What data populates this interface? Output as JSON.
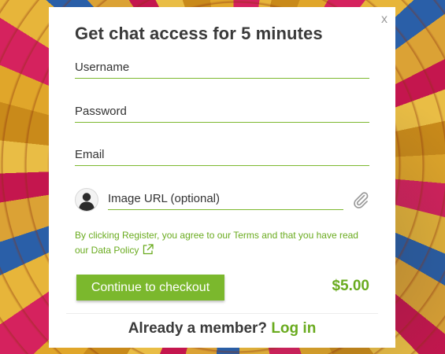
{
  "dialog": {
    "title": "Get chat access for 5 minutes",
    "close_label": "x"
  },
  "form": {
    "username_placeholder": "Username",
    "password_placeholder": "Password",
    "email_placeholder": "Email",
    "image_url_placeholder": "Image URL (optional)"
  },
  "icons": {
    "avatar": "user-silhouette-icon",
    "attach": "paperclip-icon",
    "external_link": "external-link-icon"
  },
  "terms": {
    "text": "By clicking Register, you agree to our Terms and that you have read our Data Policy"
  },
  "checkout": {
    "button_label": "Continue to checkout",
    "price": "$5.00"
  },
  "footer": {
    "prompt": "Already a member? ",
    "login_label": "Log in"
  },
  "colors": {
    "accent_green": "#7bb82d",
    "title_text": "#3a3a3a",
    "close_gray": "#9a9a9a"
  }
}
